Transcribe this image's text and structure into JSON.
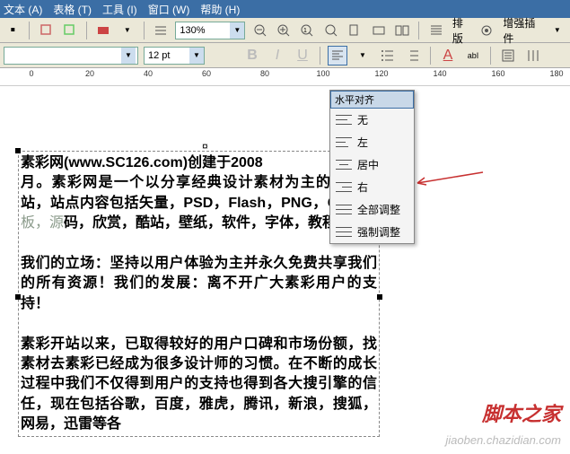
{
  "menubar": {
    "text": "文本 (A)",
    "table": "表格 (T)",
    "tool": "工具 (I)",
    "window": "窗口 (W)",
    "help": "帮助 (H)"
  },
  "toolbar1": {
    "zoom": "130%",
    "layout": "排版",
    "plugins": "增强插件"
  },
  "toolbar2": {
    "fontsize": "12 pt"
  },
  "ruler": {
    "ticks": [
      "0",
      "20",
      "40",
      "60",
      "80",
      "100",
      "120",
      "140",
      "160",
      "180"
    ]
  },
  "dropdown": {
    "title": "水平对齐",
    "items": [
      "无",
      "左",
      "居中",
      "右",
      "全部调整",
      "强制调整"
    ]
  },
  "document": {
    "p1a": "素彩网(www.SC126.com)创建于2008",
    "p1b": "月。素彩网是一个以分享经典设计素材为主的资源网站，站点内容包括矢量，PSD，Flash，PNG，Gif，",
    "p1c_gray": "模板，源",
    "p1d": "码，欣赏，酷站，壁纸，软件，字体，教程等。",
    "p2": "我们的立场：坚持以用户体验为主并永久免费共享我们的所有资源！我们的发展：离不开广大素彩用户的支持！",
    "p3": "素彩开站以来，已取得较好的用户口碑和市场份额，找素材去素彩已经成为很多设计师的习惯。在不断的成长过程中我们不仅得到用户的支持也得到各大搜引擎的信任，现在包括谷歌，百度，雅虎，腾讯，新浪，搜狐，网易，迅雷等各"
  },
  "watermark": {
    "main": "脚本之家",
    "sub": "jiaoben.chazidian.com"
  }
}
